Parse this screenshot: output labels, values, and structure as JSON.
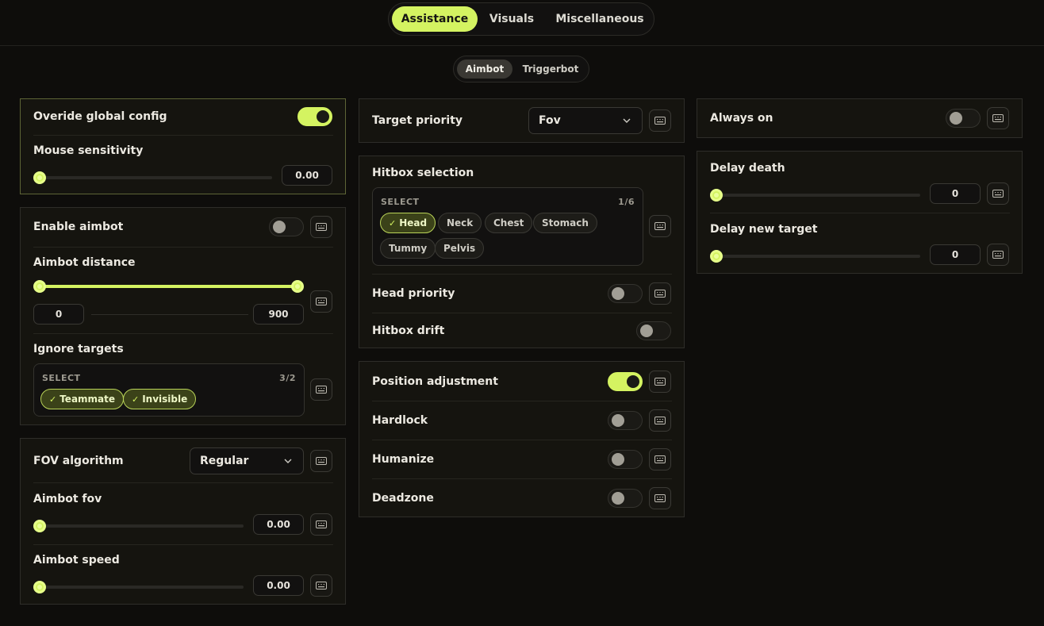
{
  "nav": {
    "tabs": [
      "Assistance",
      "Visuals",
      "Miscellaneous"
    ],
    "active": "Assistance"
  },
  "subnav": {
    "tabs": [
      "Aimbot",
      "Triggerbot"
    ],
    "active": "Aimbot"
  },
  "left": {
    "override_label": "Overide global config",
    "override_on": true,
    "mouse_sens_label": "Mouse sensitivity",
    "mouse_sens_value": "0.00",
    "enable_aimbot_label": "Enable aimbot",
    "enable_aimbot_on": false,
    "distance_label": "Aimbot distance",
    "distance_min": "0",
    "distance_max": "900",
    "ignore_label": "Ignore targets",
    "ignore_select_caption": "SELECT",
    "ignore_count": "3/2",
    "ignore_chips": [
      "Teammate",
      "Invisible"
    ],
    "fov_algo_label": "FOV algorithm",
    "fov_algo_value": "Regular",
    "aimbot_fov_label": "Aimbot fov",
    "aimbot_fov_value": "0.00",
    "aimbot_speed_label": "Aimbot speed",
    "aimbot_speed_value": "0.00"
  },
  "middle": {
    "target_priority_label": "Target priority",
    "target_priority_value": "Fov",
    "hitbox_label": "Hitbox selection",
    "hitbox_select_caption": "SELECT",
    "hitbox_count": "1/6",
    "hitbox_chips": [
      "Head",
      "Neck",
      "Chest",
      "Stomach",
      "Tummy",
      "Pelvis"
    ],
    "hitbox_selected": [
      "Head"
    ],
    "head_priority_label": "Head priority",
    "head_priority_on": false,
    "hitbox_drift_label": "Hitbox drift",
    "hitbox_drift_on": false,
    "position_adj_label": "Position adjustment",
    "position_adj_on": true,
    "hardlock_label": "Hardlock",
    "hardlock_on": false,
    "humanize_label": "Humanize",
    "humanize_on": false,
    "deadzone_label": "Deadzone",
    "deadzone_on": false
  },
  "right": {
    "always_on_label": "Always on",
    "always_on_on": false,
    "delay_death_label": "Delay death",
    "delay_death_value": "0",
    "delay_new_target_label": "Delay new target",
    "delay_new_target_value": "0"
  },
  "colors": {
    "accent": "#d4f361",
    "background": "#0e0d0b",
    "panel": "#15140f"
  }
}
